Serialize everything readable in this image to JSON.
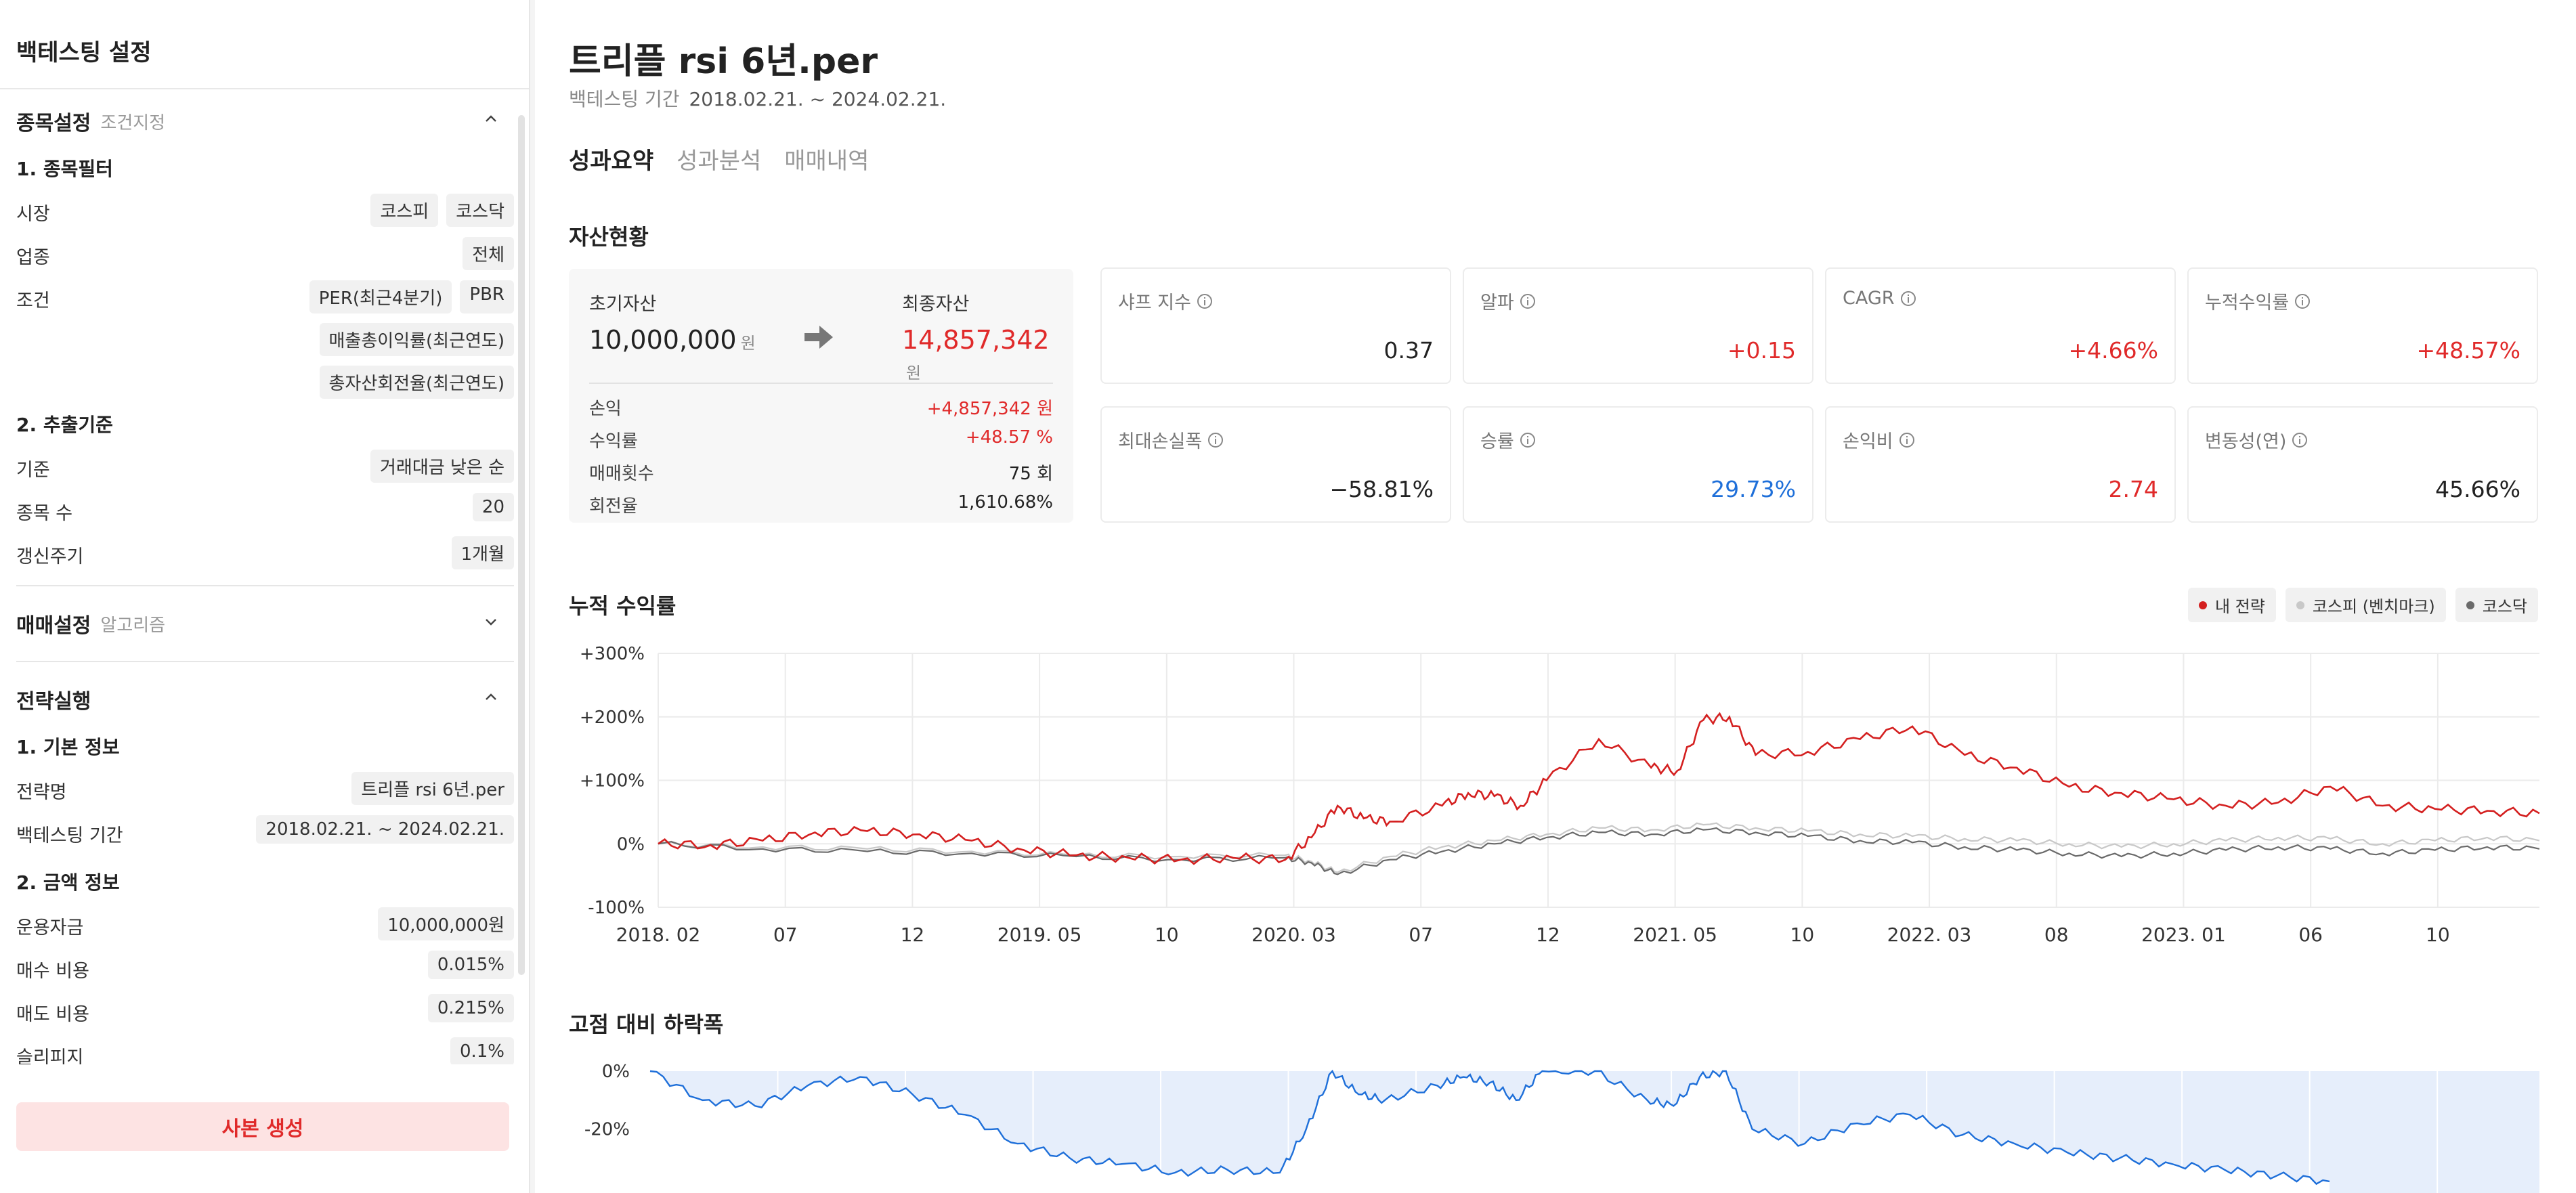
{
  "sidebar": {
    "title": "백테스팅 설정",
    "section1": {
      "title": "종목설정",
      "subtitle": "조건지정",
      "group1": "1. 종목필터",
      "market_label": "시장",
      "market": [
        "코스피",
        "코스닥"
      ],
      "industry_label": "업종",
      "industry": "전체",
      "condition_label": "조건",
      "conditions": [
        "PER(최근4분기)",
        "PBR",
        "매출총이익률(최근연도)",
        "총자산회전율(최근연도)"
      ],
      "group2": "2. 추출기준",
      "basis_label": "기준",
      "basis": "거래대금 낮은 순",
      "count_label": "종목 수",
      "count": "20",
      "cycle_label": "갱신주기",
      "cycle": "1개월"
    },
    "section2": {
      "title": "매매설정",
      "subtitle": "알고리즘"
    },
    "section3": {
      "title": "전략실행",
      "group1": "1. 기본 정보",
      "name_label": "전략명",
      "name": "트리플 rsi 6년.per",
      "period_label": "백테스팅 기간",
      "period": "2018.02.21. ~ 2024.02.21.",
      "group2": "2. 금액 정보",
      "capital_label": "운용자금",
      "capital": "10,000,000원",
      "buy_cost_label": "매수 비용",
      "buy_cost": "0.015%",
      "sell_cost_label": "매도 비용",
      "sell_cost": "0.215%",
      "slippage_label": "슬리피지",
      "slippage": "0.1%"
    },
    "copy_button": "사본 생성"
  },
  "main": {
    "title": "트리플 rsi 6년.per",
    "period_label": "백테스팅 기간",
    "period_value": "2018.02.21. ~ 2024.02.21.",
    "tabs": [
      "성과요약",
      "성과분석",
      "매매내역"
    ],
    "asset_title": "자산현황",
    "asset": {
      "initial_label": "초기자산",
      "initial_value": "10,000,000",
      "initial_unit": "원",
      "final_label": "최종자산",
      "final_value": "14,857,342",
      "final_unit": "원",
      "rows": [
        {
          "label": "손익",
          "value": "+4,857,342 원"
        },
        {
          "label": "수익률",
          "value": "+48.57 %"
        },
        {
          "label": "매매횟수",
          "value": "75 회"
        },
        {
          "label": "회전율",
          "value": "1,610.68%"
        }
      ]
    },
    "metrics": [
      {
        "label": "샤프 지수",
        "value": "0.37"
      },
      {
        "label": "알파",
        "value": "+0.15"
      },
      {
        "label": "CAGR",
        "value": "+4.66%"
      },
      {
        "label": "누적수익률",
        "value": "+48.57%"
      },
      {
        "label": "최대손실폭",
        "value": "−58.81%"
      },
      {
        "label": "승률",
        "value": "29.73%"
      },
      {
        "label": "손익비",
        "value": "2.74"
      },
      {
        "label": "변동성(연)",
        "value": "45.66%"
      }
    ],
    "cum_title": "누적 수익률",
    "dd_title": "고점 대비 하락폭",
    "legend": [
      "내 전략",
      "코스피 (벤치마크)",
      "코스닥"
    ]
  },
  "colors": {
    "strategy": "#d42020",
    "kospi": "#c8c8c8",
    "kosdaq": "#6a6a6a",
    "positive": "#e02a2a",
    "blue": "#1e6fd9",
    "dd_fill": "#e6eefb"
  },
  "chart_data": [
    {
      "type": "line",
      "title": "누적 수익률",
      "x_ticks": [
        "2018. 02",
        "07",
        "12",
        "2019. 05",
        "10",
        "2020. 03",
        "07",
        "12",
        "2021. 05",
        "10",
        "2022. 03",
        "08",
        "2023. 01",
        "06",
        "10"
      ],
      "y_ticks": [
        "+300%",
        "+200%",
        "+100%",
        "0%",
        "-100%"
      ],
      "ylim": [
        -100,
        300
      ],
      "series": [
        {
          "name": "내 전략",
          "x": [
            0,
            2,
            4,
            6,
            8,
            10,
            12,
            14,
            16,
            18,
            20,
            22,
            24,
            25,
            26,
            27,
            28,
            30,
            31,
            32,
            33,
            34,
            36,
            38,
            39,
            40,
            41,
            42,
            44,
            46,
            48,
            50,
            52,
            54,
            56,
            58,
            60,
            62,
            64,
            66,
            68,
            70,
            72
          ],
          "values": [
            0,
            -2,
            5,
            18,
            20,
            15,
            5,
            -10,
            -18,
            -22,
            -25,
            -22,
            -25,
            10,
            60,
            40,
            35,
            60,
            80,
            75,
            60,
            100,
            165,
            120,
            115,
            195,
            200,
            140,
            145,
            165,
            185,
            140,
            120,
            90,
            80,
            70,
            60,
            65,
            90,
            60,
            55,
            52,
            48
          ]
        },
        {
          "name": "코스피 (벤치마크)",
          "x": [
            0,
            4,
            8,
            12,
            16,
            20,
            24,
            25,
            26,
            28,
            30,
            32,
            34,
            36,
            38,
            40,
            42,
            44,
            46,
            48,
            50,
            52,
            54,
            56,
            58,
            60,
            62,
            64,
            66,
            68,
            70,
            72
          ],
          "values": [
            0,
            -5,
            -8,
            -12,
            -18,
            -20,
            -18,
            -28,
            -45,
            -20,
            -5,
            5,
            15,
            25,
            22,
            30,
            25,
            20,
            15,
            12,
            8,
            5,
            0,
            -5,
            0,
            5,
            10,
            8,
            0,
            5,
            10,
            5
          ]
        },
        {
          "name": "코스닥",
          "x": [
            0,
            4,
            8,
            12,
            16,
            20,
            24,
            25,
            26,
            28,
            30,
            32,
            34,
            36,
            38,
            40,
            42,
            44,
            46,
            48,
            50,
            52,
            54,
            56,
            58,
            60,
            62,
            64,
            66,
            68,
            70,
            72
          ],
          "values": [
            0,
            -8,
            -12,
            -15,
            -20,
            -25,
            -22,
            -30,
            -48,
            -25,
            -12,
            0,
            10,
            18,
            15,
            22,
            18,
            12,
            5,
            2,
            -5,
            -10,
            -15,
            -20,
            -15,
            -10,
            -5,
            -8,
            -15,
            -10,
            -5,
            -8
          ]
        }
      ]
    },
    {
      "type": "area",
      "title": "고점 대비 하락폭",
      "y_ticks": [
        "0%",
        "-20%"
      ],
      "series": [
        {
          "name": "내 전략",
          "x": [
            0,
            2,
            4,
            6,
            8,
            10,
            12,
            14,
            16,
            18,
            20,
            22,
            24,
            25,
            26,
            27,
            28,
            30,
            31,
            32,
            33,
            34,
            36,
            38,
            39,
            40,
            41,
            42,
            44,
            46,
            48,
            50,
            52,
            54,
            56,
            58,
            60,
            62,
            64
          ],
          "values": [
            0,
            -10,
            -12,
            -5,
            -2,
            -8,
            -15,
            -25,
            -30,
            -32,
            -35,
            -34,
            -35,
            -20,
            0,
            -8,
            -10,
            -5,
            -2,
            -4,
            -10,
            0,
            0,
            -10,
            -12,
            -2,
            0,
            -20,
            -25,
            -18,
            -15,
            -22,
            -25,
            -28,
            -30,
            -32,
            -34,
            -36,
            -38
          ]
        }
      ]
    }
  ]
}
